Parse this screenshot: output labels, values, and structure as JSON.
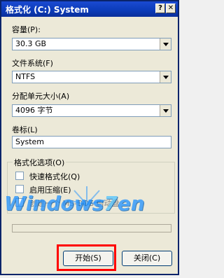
{
  "window": {
    "title": "格式化 (C:) System",
    "help_button": "?",
    "close_button": "✕"
  },
  "capacity": {
    "label": "容量(P):",
    "value": "30.3 GB"
  },
  "filesystem": {
    "label": "文件系统(F)",
    "value": "NTFS"
  },
  "allocation": {
    "label": "分配单元大小(A)",
    "value": "4096 字节"
  },
  "volume_label": {
    "label": "卷标(L)",
    "value": "System"
  },
  "format_options": {
    "title": "格式化选项(O)",
    "quick_format": "快速格式化(Q)",
    "compression": "启用压缩(E)",
    "msdos_boot": "创建一个 MS-DOS 启动盘"
  },
  "watermark": {
    "prefix": "Windows",
    "seven": "7",
    "suffix": "en"
  },
  "buttons": {
    "start": "开始(S)",
    "close": "关闭(C)"
  }
}
